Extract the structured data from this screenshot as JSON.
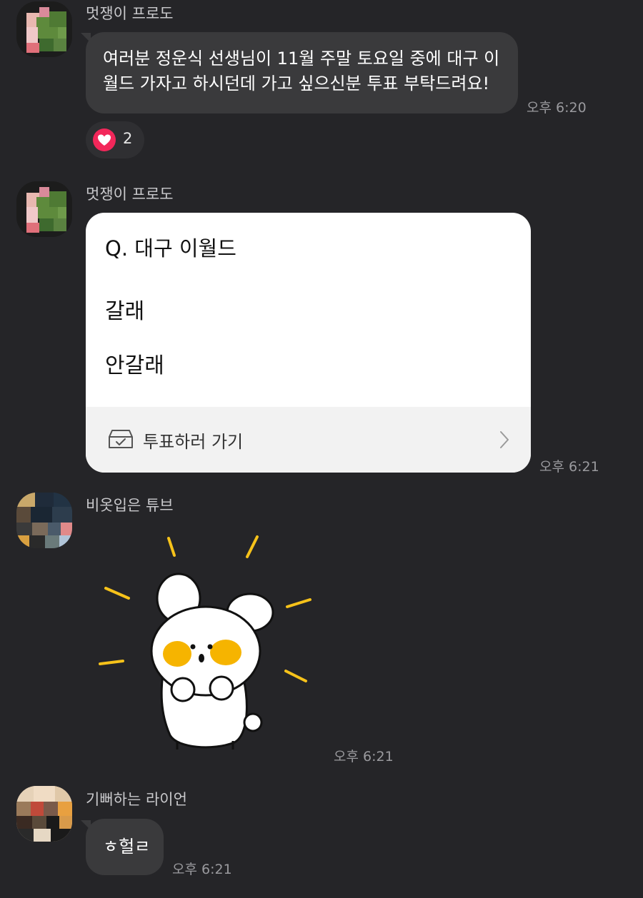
{
  "messages": [
    {
      "sender": "멋쟁이 프로도",
      "lines": [
        "여러분 정운식 선생님이 11월 주말 토요일 중에 대구 이",
        "월드 가자고 하시던데 가고 싶으신분 투표 부탁드려요!"
      ],
      "time": "오후 6:20",
      "reaction": {
        "icon": "heart-icon",
        "count": "2"
      }
    },
    {
      "sender": "멋쟁이 프로도",
      "poll": {
        "question": "Q. 대구 이월드",
        "options": [
          "갈래",
          "안갈래"
        ],
        "action_label": "투표하러 가기"
      },
      "time": "오후 6:21"
    },
    {
      "sender": "비옷입은 튜브",
      "sticker": "excited-white-bunny-sticker",
      "time": "오후 6:21"
    },
    {
      "sender": "기뻐하는 라이언",
      "text": "ㅎ헐ㄹ",
      "time": "오후 6:21"
    }
  ],
  "colors": {
    "background": "#252528",
    "bubble": "#3a3a3c",
    "heart": "#f2275a",
    "sticker_accent": "#f6b400"
  }
}
